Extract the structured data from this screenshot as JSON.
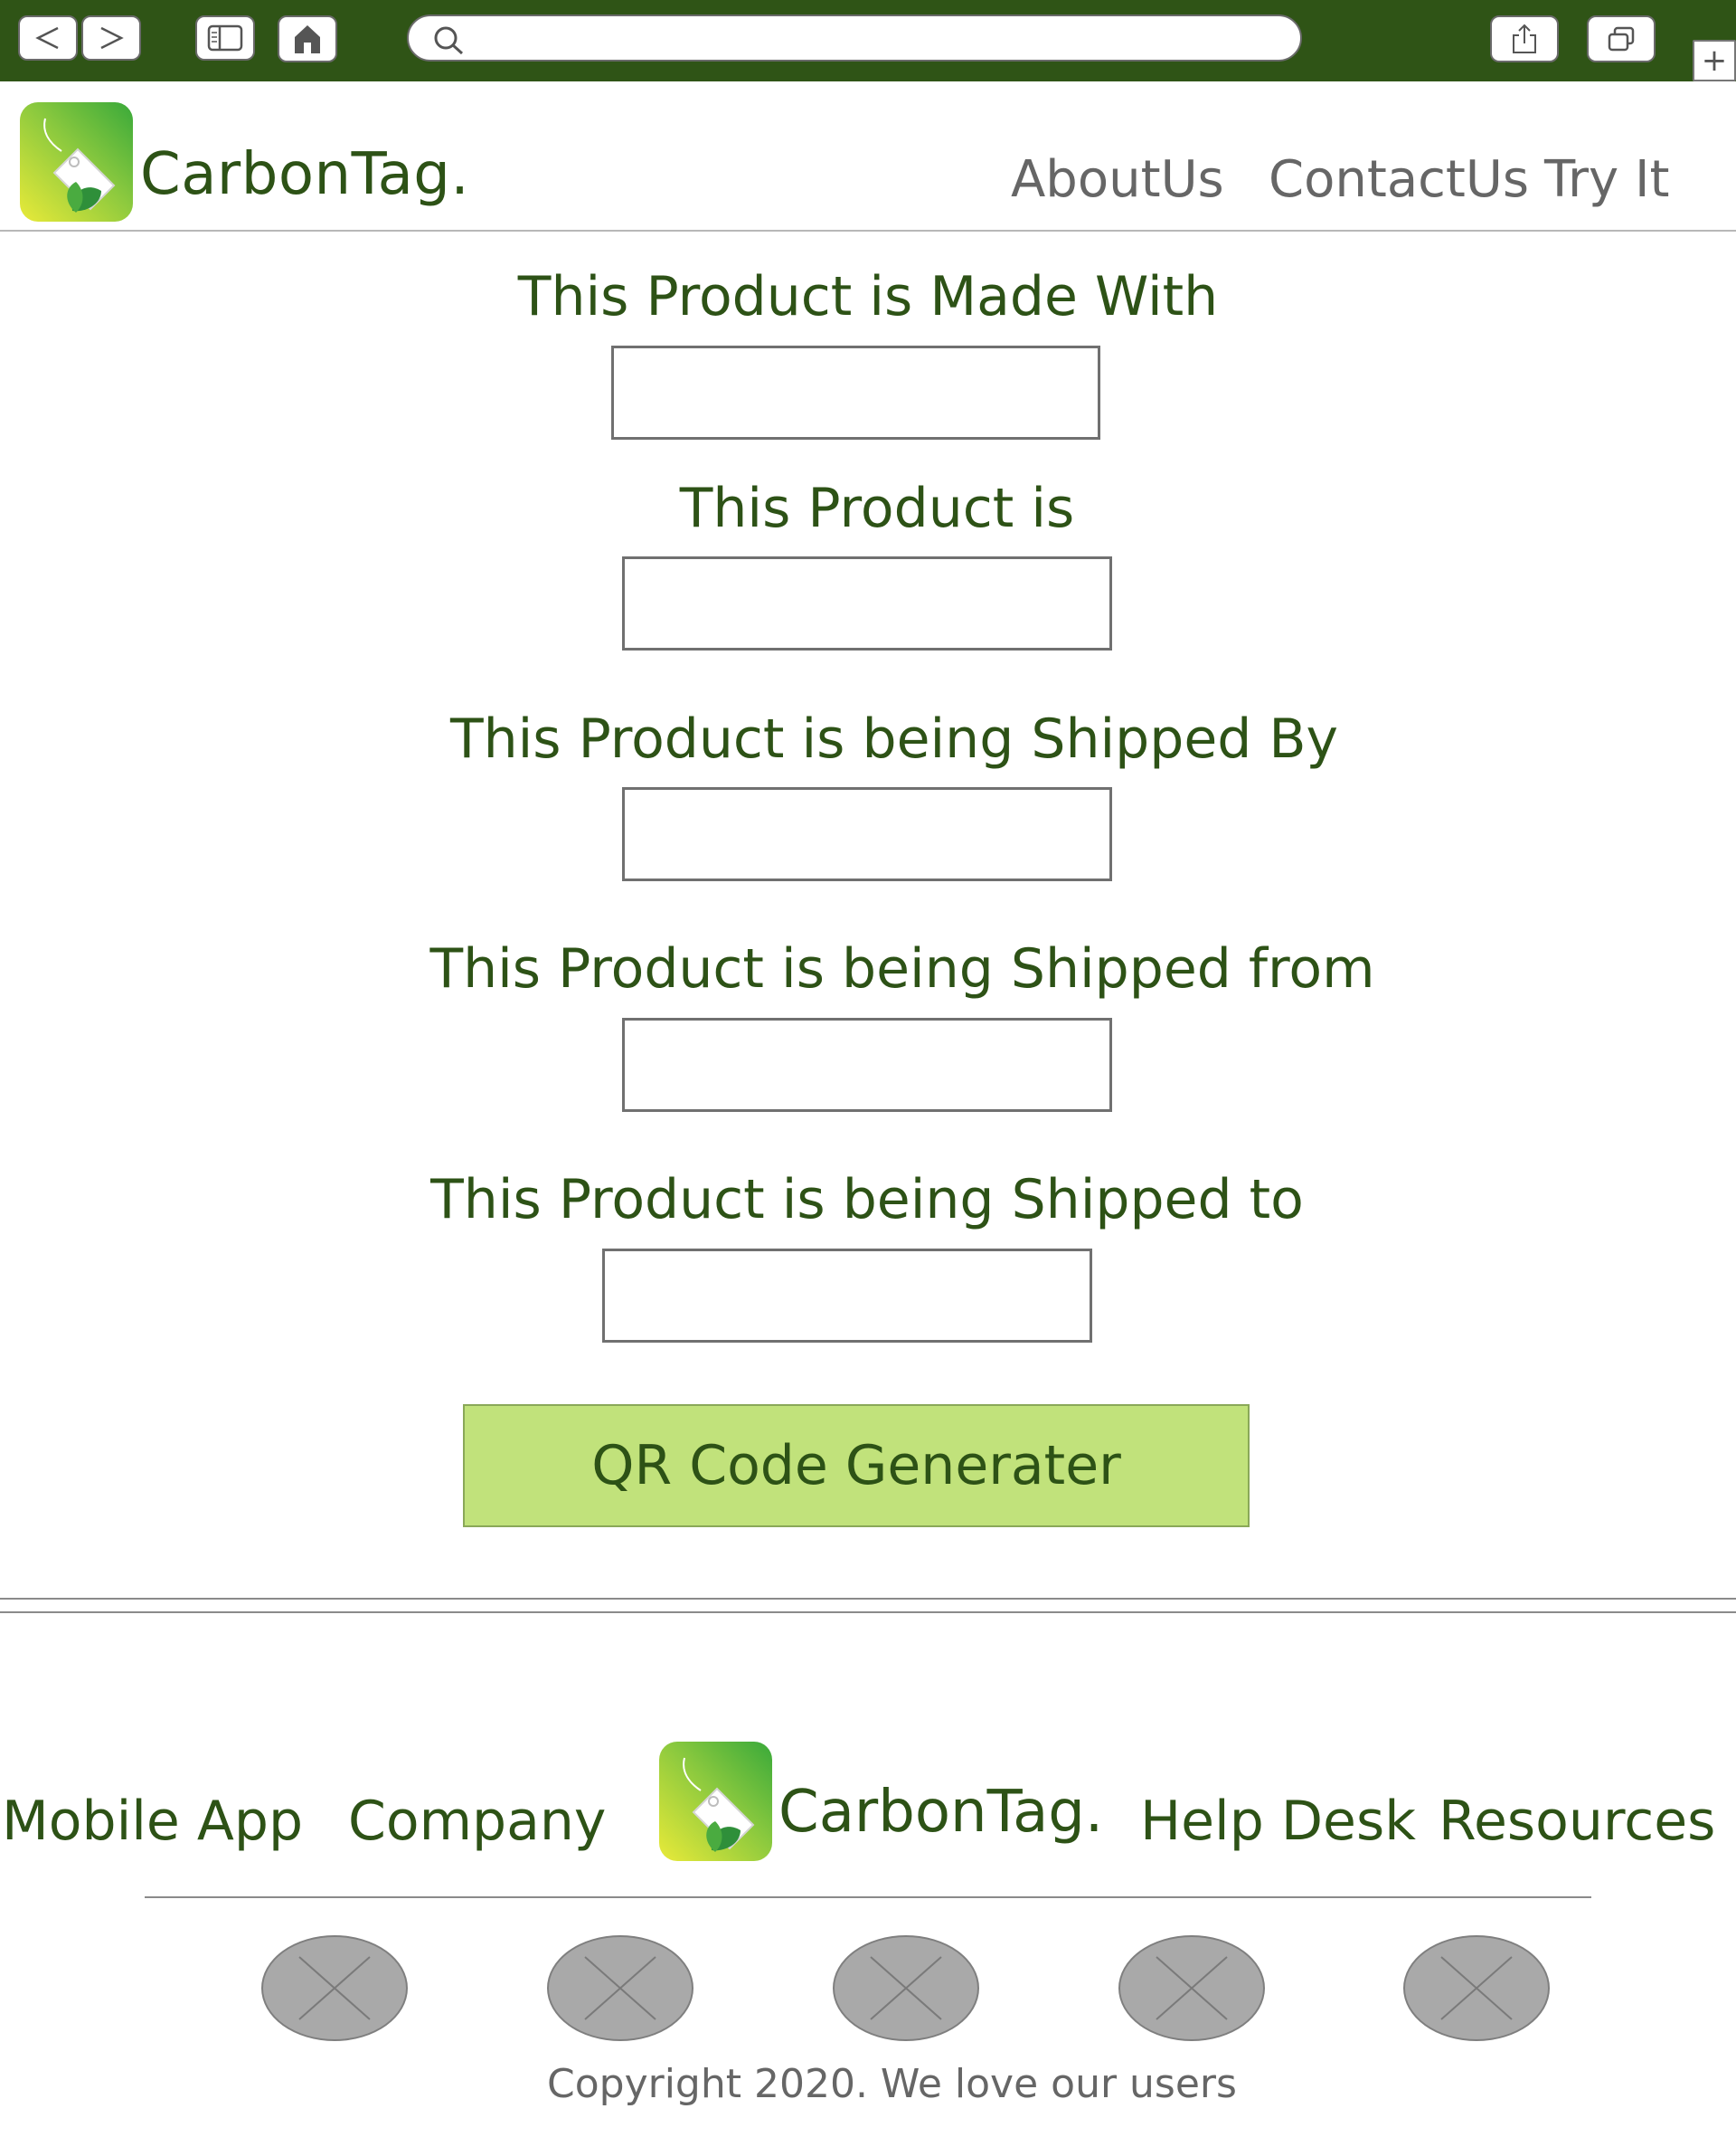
{
  "browser": {
    "back_label": "<",
    "forward_label": ">",
    "url": "",
    "new_tab_label": "+",
    "icons": [
      "chevron-left-icon",
      "chevron-right-icon",
      "sidebar-icon",
      "home-icon",
      "search-icon",
      "share-icon",
      "tabs-icon",
      "plus-icon"
    ]
  },
  "header": {
    "brand": "CarbonTag.",
    "nav": [
      "AboutUs",
      "ContactUs",
      "Try It"
    ]
  },
  "form": {
    "fields": [
      {
        "label": "This Product is Made With",
        "value": ""
      },
      {
        "label": "This Product is",
        "value": ""
      },
      {
        "label": "This Product is being Shipped By",
        "value": ""
      },
      {
        "label": "This Product is being Shipped from",
        "value": ""
      },
      {
        "label": "This Product is being Shipped to",
        "value": ""
      }
    ],
    "submit_label": "QR Code Generater"
  },
  "footer": {
    "links_left": [
      "Mobile App",
      "Company"
    ],
    "brand": "CarbonTag.",
    "links_right": [
      "Help Desk",
      "Resources"
    ],
    "social_icon_count": 5,
    "copyright": "Copyright 2020. We love our users"
  },
  "colors": {
    "chrome": "#2f5416",
    "brand_text": "#2d5216",
    "nav_text": "#666666",
    "button": "#c1e27b",
    "placeholder_icon": "#a9a9a9"
  }
}
